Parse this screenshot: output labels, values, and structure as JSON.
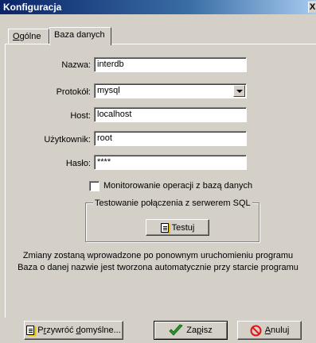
{
  "window": {
    "title": "Konfiguracja",
    "close_glyph": "X"
  },
  "tabs": [
    {
      "label_pre": "O",
      "label_rest": "gólne"
    },
    {
      "label": "Baza danych"
    }
  ],
  "form": {
    "name_label": "Nazwa:",
    "name_value": "interdb",
    "protocol_label": "Protokół:",
    "protocol_value": "mysql",
    "host_label": "Host:",
    "host_value": "localhost",
    "user_label": "Użytkownik:",
    "user_value": "root",
    "password_label": "Hasło:",
    "password_value": "****"
  },
  "monitor": {
    "label": "Monitorowanie operacji z bazą danych",
    "checked": false
  },
  "sql_test": {
    "group_title": "Testowanie połączenia z serwerem SQL",
    "button_label": "Testuj"
  },
  "info": {
    "line1": "Zmiany zostaną wprowadzone po ponownym uruchomieniu programu",
    "line2": "Baza o danej nazwie jest tworzona automatycznie przy starcie programu"
  },
  "footer": {
    "restore_pre": "P",
    "restore_mid": "r",
    "restore_post": "zywróć ",
    "restore_accel": "d",
    "restore_tail": "omyślne...",
    "save_pre": "Za",
    "save_accel": "p",
    "save_post": "isz",
    "cancel_accel": "A",
    "cancel_post": "nuluj"
  },
  "colors": {
    "face": "#d4d0c8",
    "title_start": "#0a246a",
    "save_check": "#2a9a2a",
    "cancel_red": "#d81818"
  },
  "icons": [
    "close-icon",
    "document-icon",
    "checkmark-icon",
    "cancel-icon",
    "dropdown-arrow-icon"
  ]
}
